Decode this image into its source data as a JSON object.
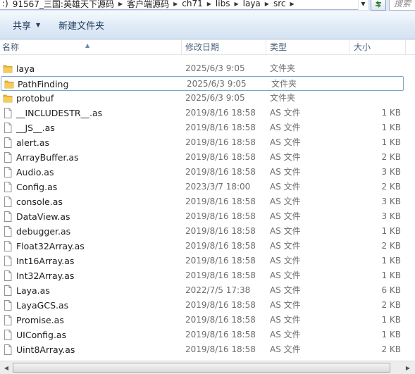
{
  "address": {
    "crumbs": [
      ":)",
      "91567_三国:英雄天下源码",
      "客户端源码",
      "ch71",
      "libs",
      "laya",
      "src"
    ],
    "search_placeholder": "搜索"
  },
  "toolbar": {
    "share_label": "共享",
    "new_folder_label": "新建文件夹"
  },
  "columns": {
    "name": "名称",
    "date": "修改日期",
    "type": "类型",
    "size": "大小"
  },
  "files": [
    {
      "name": "laya",
      "date": "2025/6/3 9:05",
      "type": "文件夹",
      "size": "",
      "kind": "folder-icon"
    },
    {
      "name": "PathFinding",
      "date": "2025/6/3 9:05",
      "type": "文件夹",
      "size": "",
      "kind": "folder-icon",
      "selected": true
    },
    {
      "name": "protobuf",
      "date": "2025/6/3 9:05",
      "type": "文件夹",
      "size": "",
      "kind": "folder-icon"
    },
    {
      "name": "__INCLUDESTR__.as",
      "date": "2019/8/16 18:58",
      "type": "AS 文件",
      "size": "1 KB",
      "kind": "file-icon"
    },
    {
      "name": "__JS__.as",
      "date": "2019/8/16 18:58",
      "type": "AS 文件",
      "size": "1 KB",
      "kind": "file-icon"
    },
    {
      "name": "alert.as",
      "date": "2019/8/16 18:58",
      "type": "AS 文件",
      "size": "1 KB",
      "kind": "file-icon"
    },
    {
      "name": "ArrayBuffer.as",
      "date": "2019/8/16 18:58",
      "type": "AS 文件",
      "size": "2 KB",
      "kind": "file-icon"
    },
    {
      "name": "Audio.as",
      "date": "2019/8/16 18:58",
      "type": "AS 文件",
      "size": "3 KB",
      "kind": "file-icon"
    },
    {
      "name": "Config.as",
      "date": "2023/3/7 18:00",
      "type": "AS 文件",
      "size": "2 KB",
      "kind": "file-icon"
    },
    {
      "name": "console.as",
      "date": "2019/8/16 18:58",
      "type": "AS 文件",
      "size": "3 KB",
      "kind": "file-icon"
    },
    {
      "name": "DataView.as",
      "date": "2019/8/16 18:58",
      "type": "AS 文件",
      "size": "3 KB",
      "kind": "file-icon"
    },
    {
      "name": "debugger.as",
      "date": "2019/8/16 18:58",
      "type": "AS 文件",
      "size": "1 KB",
      "kind": "file-icon"
    },
    {
      "name": "Float32Array.as",
      "date": "2019/8/16 18:58",
      "type": "AS 文件",
      "size": "2 KB",
      "kind": "file-icon"
    },
    {
      "name": "Int16Array.as",
      "date": "2019/8/16 18:58",
      "type": "AS 文件",
      "size": "1 KB",
      "kind": "file-icon"
    },
    {
      "name": "Int32Array.as",
      "date": "2019/8/16 18:58",
      "type": "AS 文件",
      "size": "1 KB",
      "kind": "file-icon"
    },
    {
      "name": "Laya.as",
      "date": "2022/7/5 17:38",
      "type": "AS 文件",
      "size": "6 KB",
      "kind": "file-icon"
    },
    {
      "name": "LayaGCS.as",
      "date": "2019/8/16 18:58",
      "type": "AS 文件",
      "size": "2 KB",
      "kind": "file-icon"
    },
    {
      "name": "Promise.as",
      "date": "2019/8/16 18:58",
      "type": "AS 文件",
      "size": "1 KB",
      "kind": "file-icon"
    },
    {
      "name": "UIConfig.as",
      "date": "2019/8/16 18:58",
      "type": "AS 文件",
      "size": "1 KB",
      "kind": "file-icon"
    },
    {
      "name": "Uint8Array.as",
      "date": "2019/8/16 18:58",
      "type": "AS 文件",
      "size": "2 KB",
      "kind": "file-icon"
    }
  ],
  "colors": {
    "folder": "#e8b93c",
    "selection_border": "#7da2ce",
    "toolbar_text": "#1e395b",
    "header_text": "#4c607a",
    "meta_text": "#6d6d6d"
  }
}
